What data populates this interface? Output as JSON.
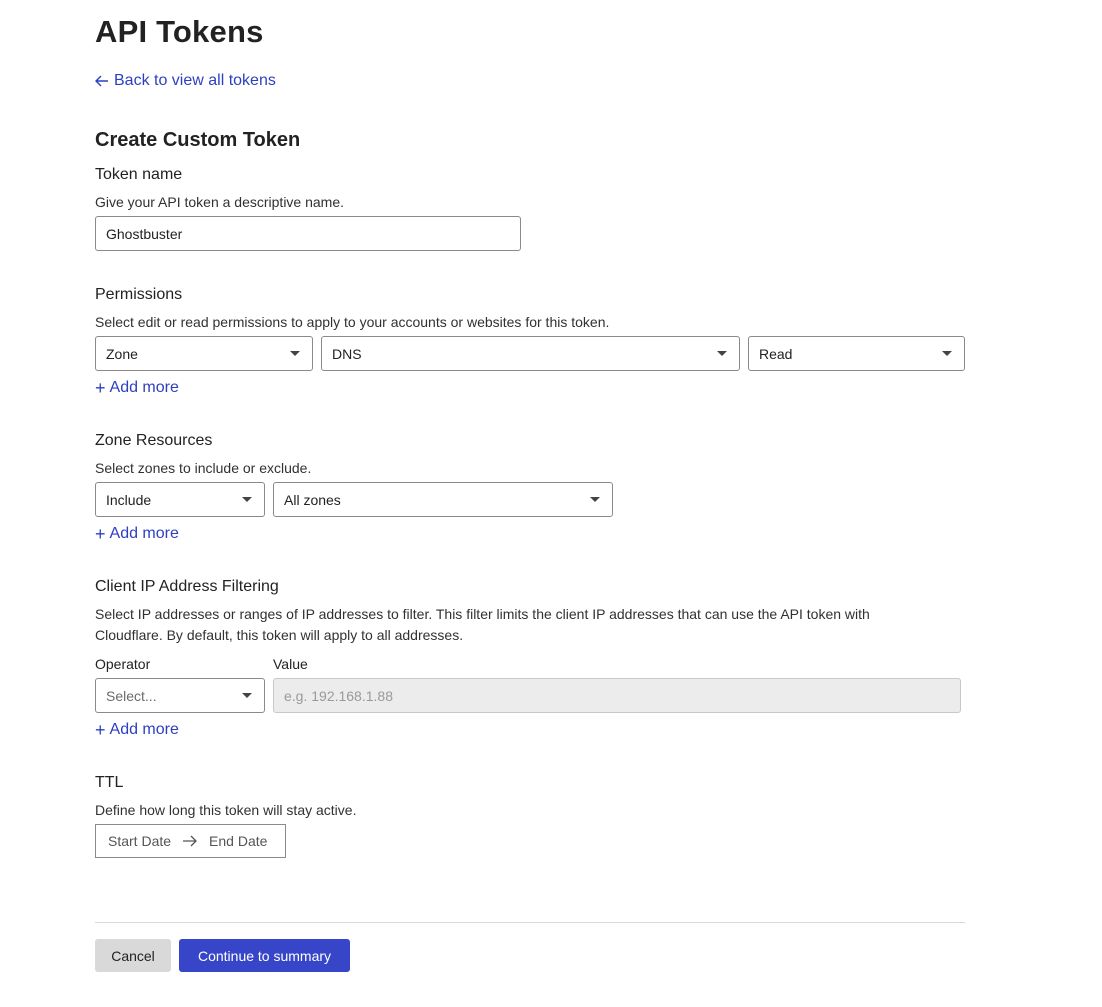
{
  "page": {
    "title": "API Tokens",
    "back_link": "Back to view all tokens",
    "section_title": "Create Custom Token"
  },
  "token_name": {
    "label": "Token name",
    "help": "Give your API token a descriptive name.",
    "value": "Ghostbuster"
  },
  "permissions": {
    "label": "Permissions",
    "help": "Select edit or read permissions to apply to your accounts or websites for this token.",
    "scope": "Zone",
    "resource": "DNS",
    "access": "Read",
    "add_more": "Add more"
  },
  "zone_resources": {
    "label": "Zone Resources",
    "help": "Select zones to include or exclude.",
    "mode": "Include",
    "target": "All zones",
    "add_more": "Add more"
  },
  "ip_filtering": {
    "label": "Client IP Address Filtering",
    "help": "Select IP addresses or ranges of IP addresses to filter. This filter limits the client IP addresses that can use the API token with Cloudflare. By default, this token will apply to all addresses.",
    "operator_label": "Operator",
    "operator_placeholder": "Select...",
    "value_label": "Value",
    "value_placeholder": "e.g. 192.168.1.88",
    "add_more": "Add more"
  },
  "ttl": {
    "label": "TTL",
    "help": "Define how long this token will stay active.",
    "start_placeholder": "Start Date",
    "end_placeholder": "End Date"
  },
  "footer": {
    "cancel": "Cancel",
    "continue": "Continue to summary"
  },
  "colors": {
    "link": "#2c3fc2",
    "primary_button": "#3745c8",
    "cancel_button": "#d9d9d9"
  }
}
